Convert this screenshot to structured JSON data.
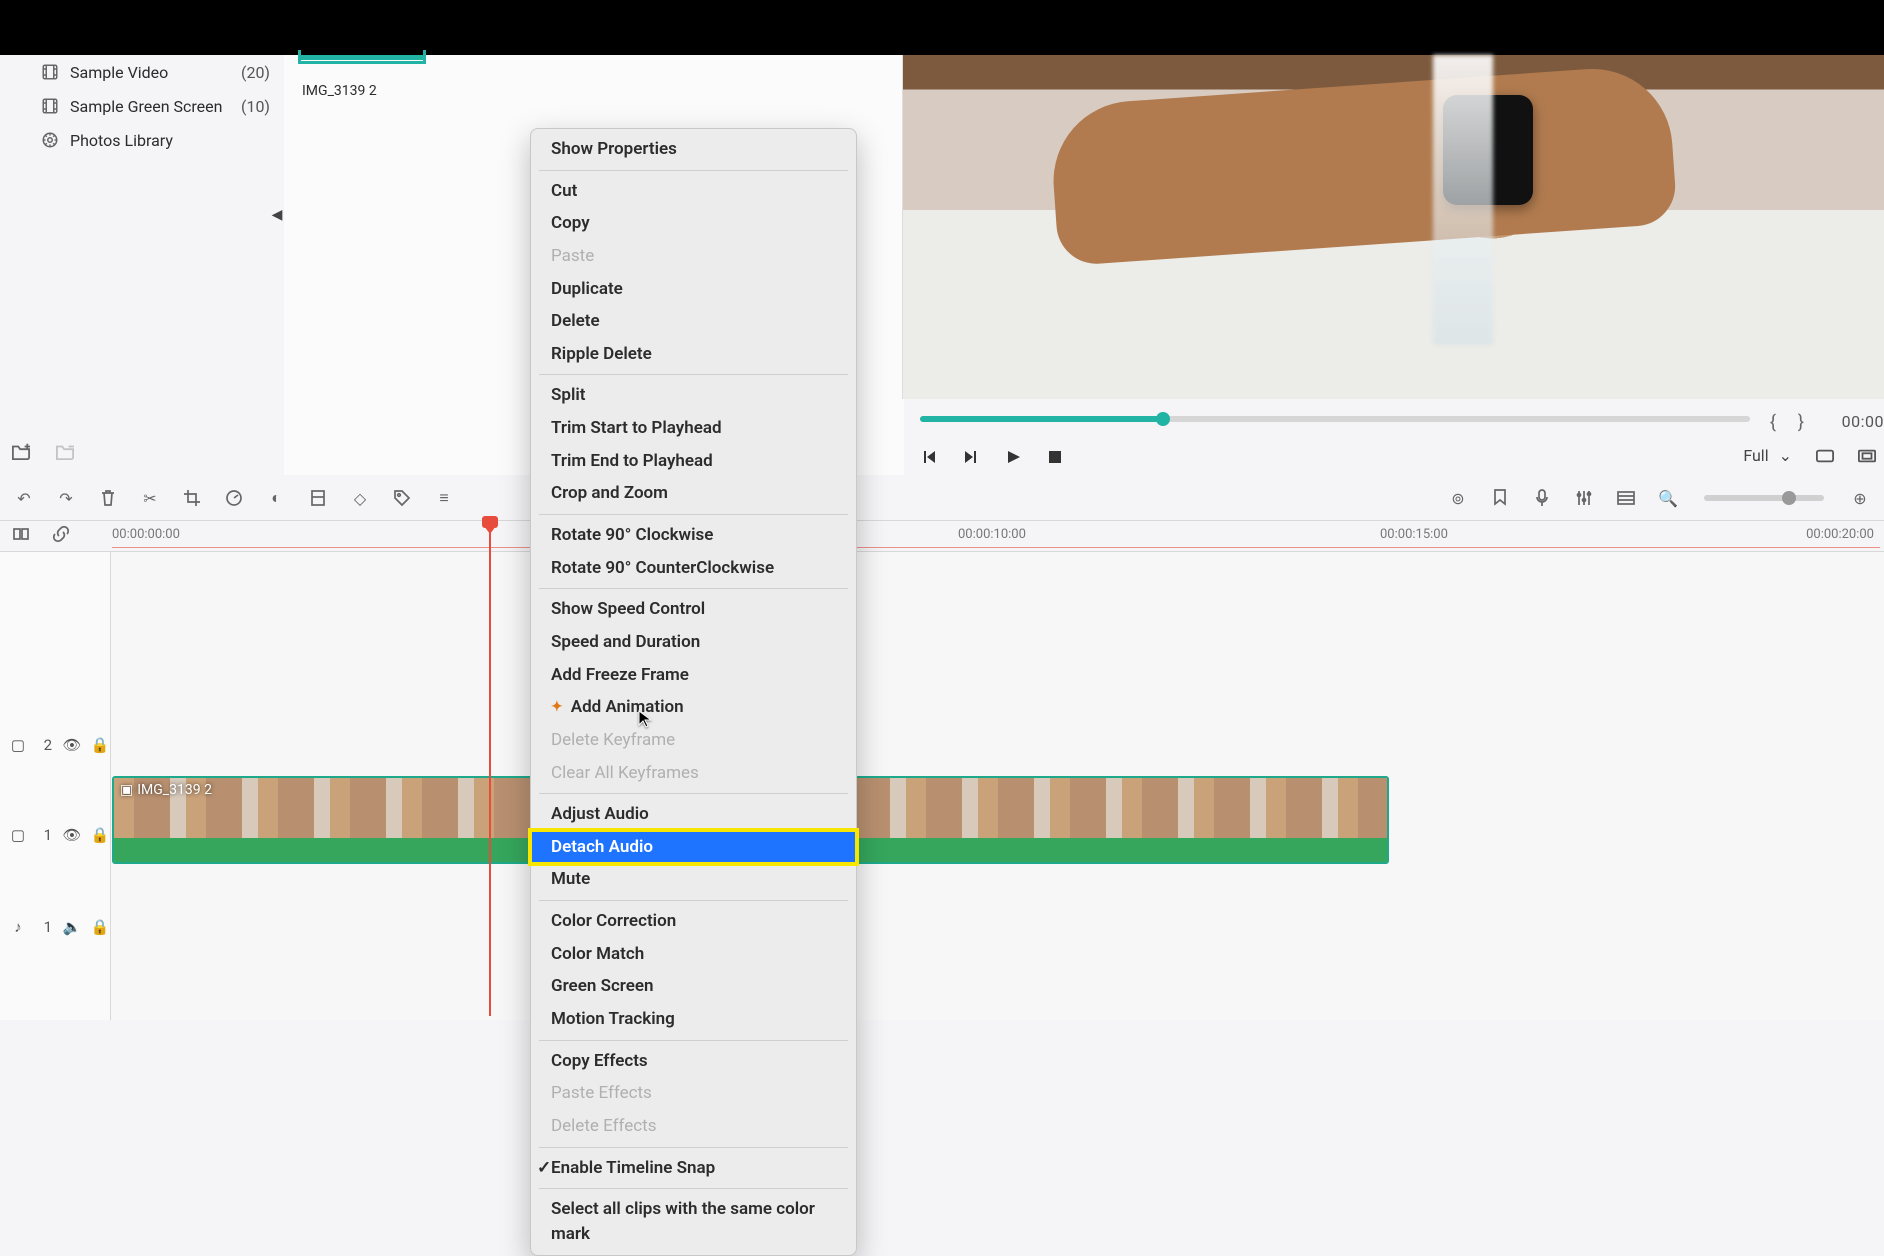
{
  "sidebar": {
    "items": [
      {
        "label": "Sample Video",
        "count": "(20)",
        "icon": "film-icon"
      },
      {
        "label": "Sample Green Screen",
        "count": "(10)",
        "icon": "film-icon"
      },
      {
        "label": "Photos Library",
        "count": "",
        "icon": "photos-icon"
      }
    ]
  },
  "media": {
    "thumb_caption": "IMG_3139 2"
  },
  "preview": {
    "quality_select": "Full",
    "timecode_right": "00:00"
  },
  "ruler": {
    "t0": "00:00:00:00",
    "t10": "00:00:10:00",
    "t15": "00:00:15:00",
    "t20": "00:00:20:00"
  },
  "tracks": {
    "v2_label": "2",
    "v1_label": "1",
    "a1_label": "1"
  },
  "clip": {
    "name": "IMG_3139 2"
  },
  "menu": {
    "groups": [
      [
        "Show Properties"
      ],
      [
        "Cut",
        "Copy",
        "_Paste",
        "Duplicate",
        "Delete",
        "Ripple Delete"
      ],
      [
        "Split",
        "Trim Start to Playhead",
        "Trim End to Playhead",
        "Crop and Zoom"
      ],
      [
        "Rotate 90° Clockwise",
        "Rotate 90° CounterClockwise"
      ],
      [
        "Show Speed Control",
        "Speed and Duration",
        "Add Freeze Frame",
        "*Add Animation",
        "_Delete Keyframe",
        "_Clear All Keyframes"
      ],
      [
        "Adjust Audio",
        "!Detach Audio",
        "Mute"
      ],
      [
        "Color Correction",
        "Color Match",
        "Green Screen",
        "Motion Tracking"
      ],
      [
        "Copy Effects",
        "_Paste Effects",
        "_Delete Effects"
      ],
      [
        "✓Enable Timeline Snap"
      ],
      [
        "Select all clips with the same color mark"
      ]
    ]
  }
}
